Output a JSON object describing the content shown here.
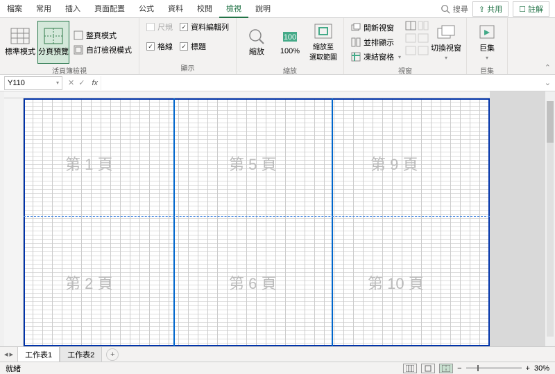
{
  "tabs": {
    "file": "檔案",
    "home": "常用",
    "insert": "插入",
    "layout": "頁面配置",
    "formulas": "公式",
    "data": "資料",
    "review": "校閱",
    "view": "檢視",
    "help": "說明"
  },
  "search": {
    "placeholder": "搜尋"
  },
  "share": {
    "label": "共用",
    "comment": "註解"
  },
  "ribbon": {
    "workbook_views": {
      "normal": "標準模式",
      "page_break": "分頁預覽",
      "page_layout": "整頁模式",
      "custom": "自訂檢視模式",
      "group": "活頁簿檢視"
    },
    "show": {
      "ruler": "尺規",
      "formula_bar": "資料編輯列",
      "gridlines": "格線",
      "headings": "標題",
      "group": "顯示"
    },
    "zoom": {
      "zoom": "縮放",
      "hundred": "100%",
      "selection": "縮放至\n選取範圍",
      "group": "縮放"
    },
    "window": {
      "new": "開新視窗",
      "arrange": "並排顯示",
      "freeze": "凍結窗格",
      "switch": "切換視窗",
      "group": "視窗"
    },
    "macros": {
      "macros": "巨集",
      "group": "巨集"
    }
  },
  "name_box": "Y110",
  "pages": {
    "p1": "第 1 頁",
    "p2": "第 2 頁",
    "p5": "第 5 頁",
    "p6": "第 6 頁",
    "p9": "第 9 頁",
    "p10": "第 10 頁"
  },
  "sheets": {
    "tab1": "工作表1",
    "tab2": "工作表2"
  },
  "status": {
    "ready": "就緒",
    "zoom": "30%"
  }
}
